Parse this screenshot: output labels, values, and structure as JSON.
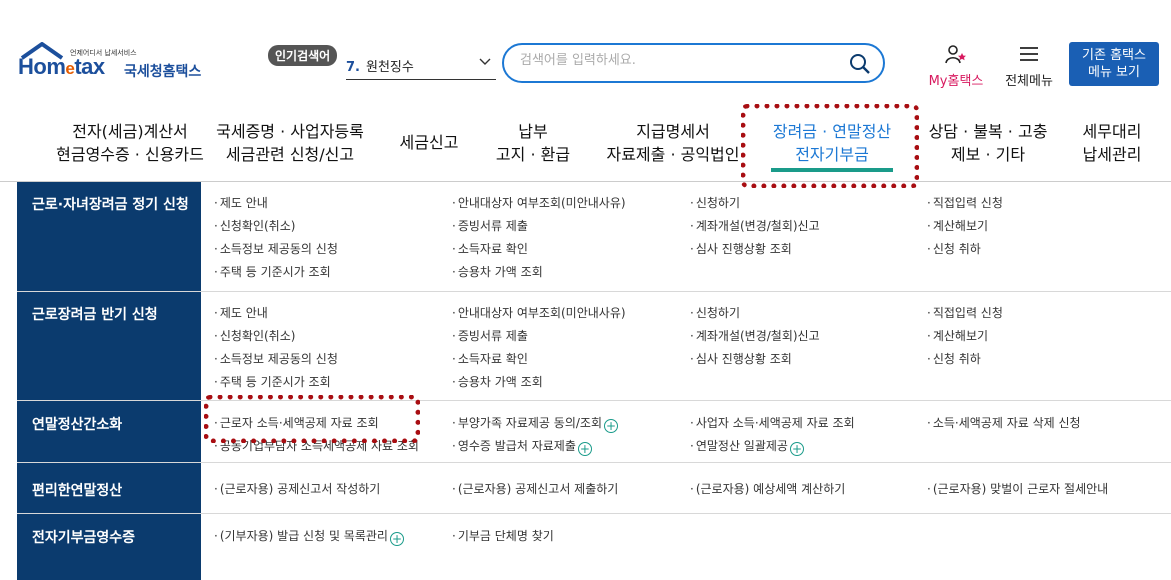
{
  "logo": {
    "tagline": "언제어디서 납세서비스",
    "home": "Hom",
    "e": "e",
    "tax": "tax",
    "kr": "국세청홈택스"
  },
  "popular": {
    "badge": "인기검색어",
    "num": "7.",
    "term": "원천징수"
  },
  "search": {
    "placeholder": "검색어를 입력하세요."
  },
  "utility": {
    "myhome": "My홈택스",
    "allmenu": "전체메뉴",
    "oldhome_line1": "기존 홈택스",
    "oldhome_line2": "메뉴 보기"
  },
  "colors": {
    "brand": "#1c4f9c",
    "accent": "#1a9b8a",
    "active": "#1c78d4",
    "section_bg": "#0b3b6e",
    "highlight": "#a80e12"
  },
  "nav": [
    {
      "l1": "전자(세금)계산서",
      "l2": "현금영수증 · 신용카드"
    },
    {
      "l1": "국세증명 · 사업자등록",
      "l2": "세금관련 신청/신고"
    },
    {
      "l1": "세금신고",
      "l2": ""
    },
    {
      "l1": "납부",
      "l2": "고지 · 환급"
    },
    {
      "l1": "지급명세서",
      "l2": "자료제출 · 공익법인"
    },
    {
      "l1": "장려금 · 연말정산",
      "l2": "전자기부금"
    },
    {
      "l1": "상담 · 불복 · 고충",
      "l2": "제보 · 기타"
    },
    {
      "l1": "세무대리",
      "l2": "납세관리"
    }
  ],
  "sections": [
    {
      "title": "근로·자녀장려금 정기 신청",
      "cols": [
        [
          "제도 안내",
          "신청확인(취소)",
          "소득정보 제공동의 신청",
          "주택 등 기준시가 조회"
        ],
        [
          "안내대상자 여부조회(미안내사유)",
          "증빙서류 제출",
          "소득자료 확인",
          "승용차 가액 조회"
        ],
        [
          "신청하기",
          "계좌개설(변경/철회)신고",
          "심사 진행상황 조회"
        ],
        [
          "직접입력 신청",
          "계산해보기",
          "신청 취하"
        ]
      ]
    },
    {
      "title": "근로장려금 반기 신청",
      "cols": [
        [
          "제도 안내",
          "신청확인(취소)",
          "소득정보 제공동의 신청",
          "주택 등 기준시가 조회"
        ],
        [
          "안내대상자 여부조회(미안내사유)",
          "증빙서류 제출",
          "소득자료 확인",
          "승용차 가액 조회"
        ],
        [
          "신청하기",
          "계좌개설(변경/철회)신고",
          "심사 진행상황 조회"
        ],
        [
          "직접입력 신청",
          "계산해보기",
          "신청 취하"
        ]
      ]
    },
    {
      "title": "연말정산간소화",
      "cols": [
        [
          "근로자 소득·세액공제 자료 조회",
          "공동기업부담자 소득세액공제 자료 조회"
        ],
        [
          "부양가족 자료제공 동의/조회",
          "영수증 발급처 자료제출"
        ],
        [
          "사업자 소득·세액공제 자료 조회",
          "연말정산 일괄제공"
        ],
        [
          "소득·세액공제 자료 삭제 신청"
        ]
      ]
    },
    {
      "title": "편리한연말정산",
      "cols": [
        [
          "(근로자용) 공제신고서 작성하기"
        ],
        [
          "(근로자용) 공제신고서 제출하기"
        ],
        [
          "(근로자용) 예상세액 계산하기"
        ],
        [
          "(근로자용) 맞벌이 근로자 절세안내"
        ]
      ]
    },
    {
      "title": "전자기부금영수증",
      "cols": [
        [
          "(기부자용) 발급 신청 및 목록관리"
        ],
        [
          "기부금 단체명 찾기"
        ]
      ]
    }
  ]
}
